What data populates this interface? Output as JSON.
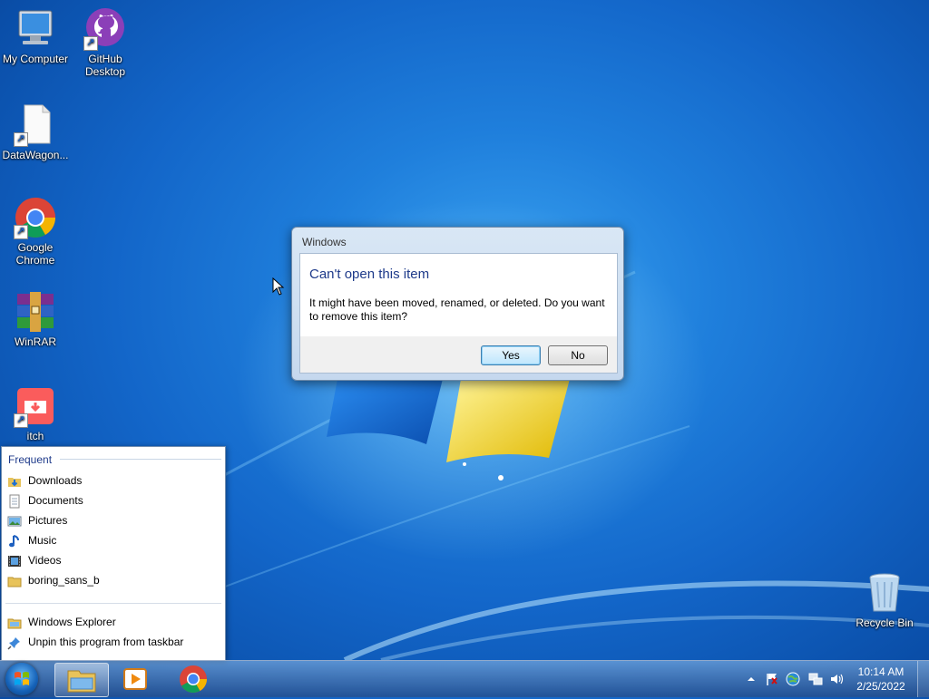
{
  "desktop": {
    "icons": [
      {
        "label": "My Computer"
      },
      {
        "label": "GitHub Desktop"
      },
      {
        "label": "DataWagon..."
      },
      {
        "label": "Google Chrome"
      },
      {
        "label": "WinRAR"
      },
      {
        "label": "itch"
      },
      {
        "label": "Recycle Bin"
      }
    ]
  },
  "dialog": {
    "window_title": "Windows",
    "main_instruction": "Can't open this item",
    "content": "It might have been moved, renamed, or deleted. Do you want to remove this item?",
    "yes_label": "Yes",
    "no_label": "No"
  },
  "jumplist": {
    "header": "Frequent",
    "frequent": [
      {
        "label": "Downloads",
        "icon": "downloads-folder-icon"
      },
      {
        "label": "Documents",
        "icon": "documents-icon"
      },
      {
        "label": "Pictures",
        "icon": "pictures-icon"
      },
      {
        "label": "Music",
        "icon": "music-icon"
      },
      {
        "label": "Videos",
        "icon": "videos-icon"
      },
      {
        "label": "boring_sans_b",
        "icon": "folder-icon"
      }
    ],
    "tasks": [
      {
        "label": "Windows Explorer",
        "icon": "windows-explorer-icon"
      },
      {
        "label": "Unpin this program from taskbar",
        "icon": "unpin-icon"
      }
    ]
  },
  "taskbar": {
    "time": "10:14 AM",
    "date": "2/25/2022"
  },
  "colors": {
    "accent": "#1e3a8a",
    "desktop_blue": "#1366c9"
  }
}
